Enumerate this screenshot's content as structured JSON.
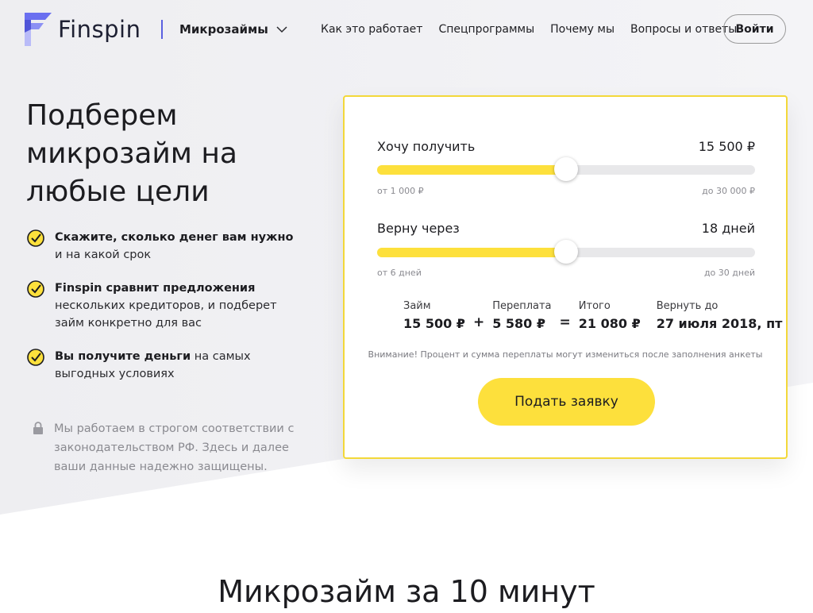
{
  "brand": {
    "name": "Finspin",
    "accent": "#5a60e0"
  },
  "header": {
    "product": "Микрозаймы",
    "nav": [
      "Как это работает",
      "Спецпрограммы",
      "Почему мы",
      "Вопросы и ответы"
    ],
    "login": "Войти"
  },
  "hero": {
    "title": "Подберем микрозайм на любые цели",
    "features": [
      {
        "bold": "Скажите, сколько денег вам нужно",
        "rest": " и на какой срок"
      },
      {
        "bold": "Finspin сравнит предложения",
        "rest": " нескольких кредиторов, и подберет займ конкретно для вас"
      },
      {
        "bold": "Вы получите деньги",
        "rest": " на самых выгодных условиях"
      }
    ],
    "secure_note": "Мы работаем в строгом соответствии с законодательством РФ. Здесь и далее ваши данные надежно защищены."
  },
  "calculator": {
    "amount": {
      "label": "Хочу получить",
      "value": "15 500 ₽",
      "min_label": "от 1 000 ₽",
      "max_label": "до 30 000 ₽",
      "level": 0.5
    },
    "term": {
      "label": "Верну через",
      "value": "18 дней",
      "min_label": "от 6 дней",
      "max_label": "до 30 дней",
      "level": 0.5
    },
    "summary": {
      "loan_label": "Займ",
      "loan_value": "15 500 ₽",
      "plus": "+",
      "overpay_label": "Переплата",
      "overpay_value": "5 580 ₽",
      "equals": "=",
      "total_label": "Итого",
      "total_value": "21 080 ₽",
      "return_label": "Вернуть до",
      "return_value": "27 июля 2018, пт"
    },
    "notice": "Внимание! Процент и сумма переплаты могут измениться после заполнения анкеты",
    "submit": "Подать заявку"
  },
  "section": {
    "title": "Микрозайм за 10 минут"
  },
  "colors": {
    "yellow": "#fde03c",
    "card_border": "#f3d83a",
    "track": "#e8e8ea"
  }
}
